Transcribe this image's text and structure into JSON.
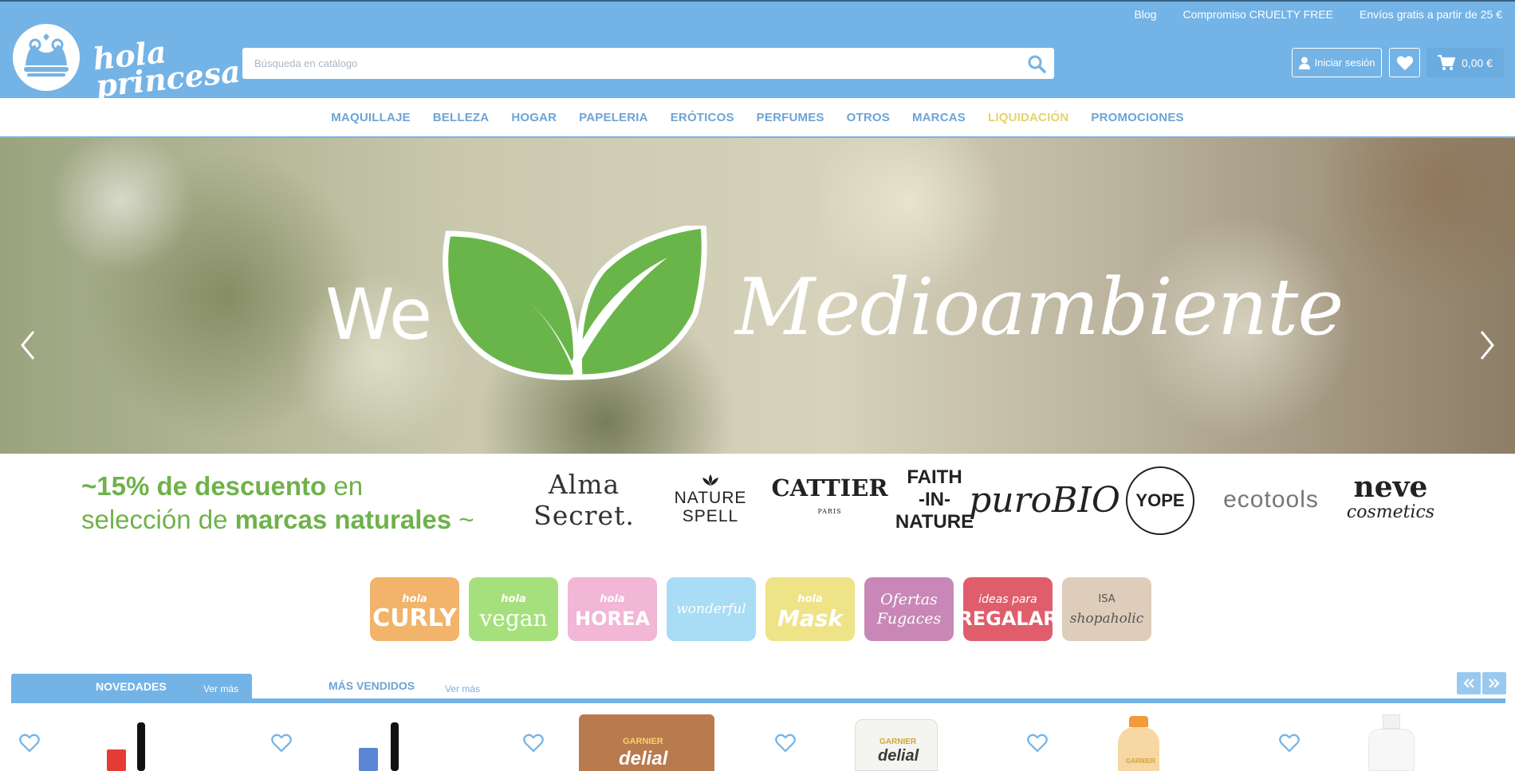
{
  "header": {
    "logo_text": "hola princesa",
    "top_links": [
      "Blog",
      "Compromiso CRUELTY FREE",
      "Envíos gratis a partir de 25 €"
    ],
    "search_placeholder": "Búsqueda en catálogo",
    "login_label": "Iniciar sesión",
    "cart_total": "0,00 €"
  },
  "nav": {
    "items": [
      "MAQUILLAJE",
      "BELLEZA",
      "HOGAR",
      "PAPELERIA",
      "ERÓTICOS",
      "PERFUMES",
      "OTROS",
      "MARCAS",
      "LIQUIDACIÓN",
      "PROMOCIONES"
    ]
  },
  "hero": {
    "word_left": "We",
    "word_right": "Medioambiente"
  },
  "promo": {
    "line1_a": "~15% de descuento",
    "line1_b": " en",
    "line2_a": "selección de ",
    "line2_b": "marcas naturales",
    "line2_c": " ~"
  },
  "brands": {
    "b1": "Alma Secret.",
    "b2_l1": "NATURE",
    "b2_l2": "SPELL",
    "b3": "CATTIER",
    "b3_sub": "PARIS",
    "b4_l1": "FAITH",
    "b4_l2": "-IN-",
    "b4_l3": "NATURE",
    "b5": "puroBIO",
    "b6": "YOPE",
    "b7": "ecotools",
    "b8": "neve",
    "b8_sub": "cosmetics"
  },
  "tiles": [
    {
      "top": "hola",
      "main": "CURLY",
      "color": "#f2b36a"
    },
    {
      "top": "hola",
      "main": "vegan",
      "color": "#a6e07c"
    },
    {
      "top": "hola",
      "main": "HOREA",
      "color": "#f2b6d6"
    },
    {
      "top": "",
      "main": "wonderful",
      "color": "#a9dcf5"
    },
    {
      "top": "hola",
      "main": "Mask",
      "color": "#eee387"
    },
    {
      "top": "Ofertas",
      "main": "Fugaces",
      "color": "#c887b6"
    },
    {
      "top": "ideas para",
      "main": "REGALAR",
      "color": "#e05e6c"
    },
    {
      "top": "ISA",
      "main": "shopaholic",
      "color": "#decdbb"
    }
  ],
  "tabs": {
    "tab1": "NOVEDADES",
    "tab1_more": "Ver más",
    "tab2": "MÁS VENDIDOS",
    "tab2_more": "Ver más"
  },
  "products": {
    "brand_label": "GARNIER",
    "product_label": "delial"
  },
  "colors": {
    "header_bg": "#74b3e6",
    "nav_text": "#6da4d4",
    "sale_text": "#e6d36e",
    "promo_green": "#6fb24b",
    "leaf_green": "#6ab54a"
  }
}
